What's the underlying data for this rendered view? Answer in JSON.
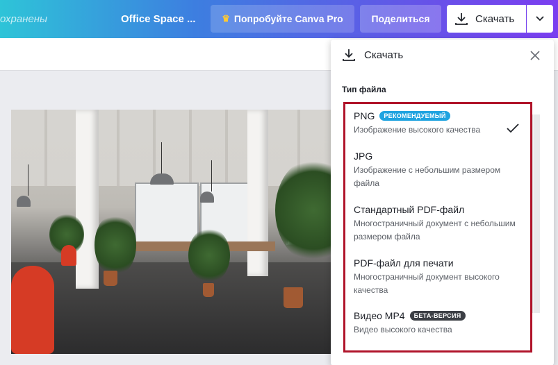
{
  "topbar": {
    "saved_text": "охранены",
    "doc_title": "Office Space   ...",
    "pro_label": "Попробуйте Canva Pro",
    "share_label": "Поделиться",
    "download_label": "Скачать",
    "icons": {
      "pro": "crown-icon",
      "download": "download-icon",
      "caret": "chevron-down-icon"
    }
  },
  "panel": {
    "title": "Скачать",
    "file_type_label": "Тип файла",
    "icons": {
      "download": "download-icon",
      "close": "close-icon",
      "selected": "check-icon"
    }
  },
  "file_types": [
    {
      "name": "PNG",
      "badge": "РЕКОМЕНДУЕМЫЙ",
      "description": "Изображение высокого качества",
      "selected": true
    },
    {
      "name": "JPG",
      "badge": "",
      "description": "Изображение с небольшим размером файла",
      "selected": false
    },
    {
      "name": "Стандартный PDF-файл",
      "badge": "",
      "description": "Многостраничный документ с небольшим размером файла",
      "selected": false
    },
    {
      "name": "PDF-файл для печати",
      "badge": "",
      "description": "Многостраничный документ высокого качества",
      "selected": false
    },
    {
      "name": "Видео MP4",
      "badge": "БЕТА-ВЕРСИЯ",
      "description": "Видео высокого качества",
      "selected": false
    }
  ],
  "colors": {
    "highlight_border": "#b0142a",
    "badge_recommended": "#1fa3e0",
    "badge_beta": "#3c3f45",
    "crown": "#ffc933"
  }
}
